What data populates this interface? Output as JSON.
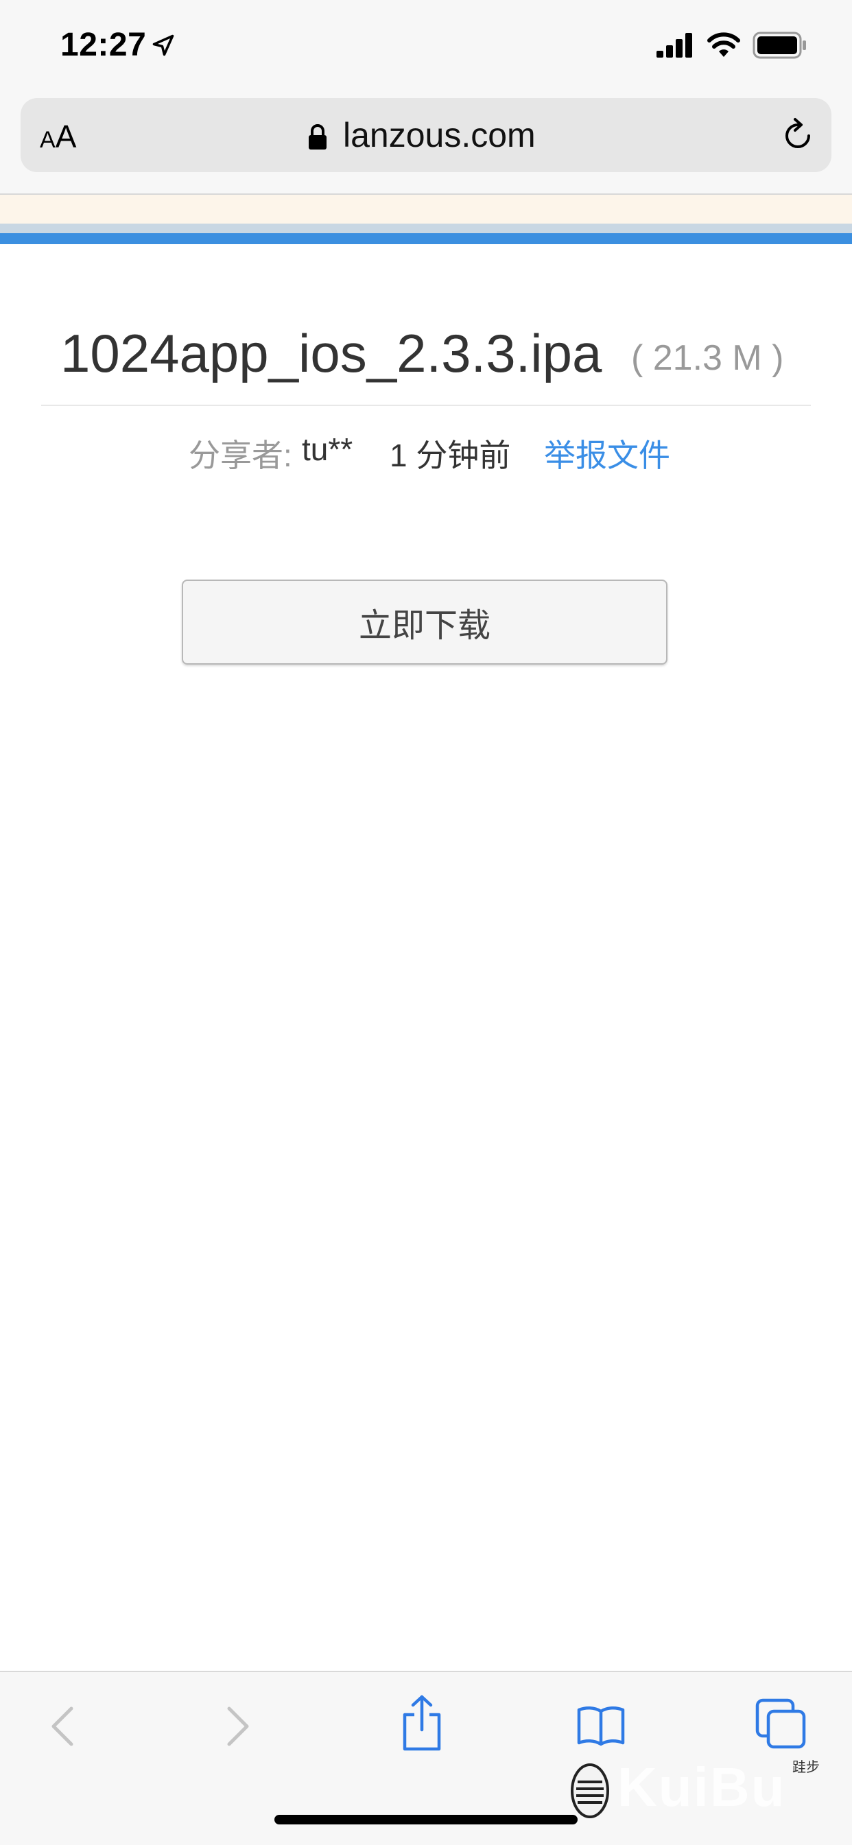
{
  "status_bar": {
    "time": "12:27",
    "icons": [
      "location-arrow-icon",
      "signal-icon",
      "wifi-icon",
      "battery-icon"
    ]
  },
  "browser": {
    "text_size_small": "A",
    "text_size_large": "A",
    "url": "lanzous.com"
  },
  "file": {
    "name": "1024app_ios_2.3.3.ipa",
    "size": "( 21.3 M )",
    "sharer_label": "分享者:",
    "sharer_name": "tu**",
    "time_ago": "1 分钟前",
    "report_label": "举报文件"
  },
  "download": {
    "label": "立即下载"
  },
  "toolbar": {
    "icons": [
      "back-icon",
      "forward-icon",
      "share-icon",
      "bookmarks-icon",
      "tabs-icon"
    ]
  },
  "watermark": {
    "text": "KuiBu",
    "subtext": "跬步"
  },
  "colors": {
    "link": "#3a8ee6",
    "accent_strip": "#3b8fe0",
    "toolbar_icon": "#2f7ae5"
  }
}
